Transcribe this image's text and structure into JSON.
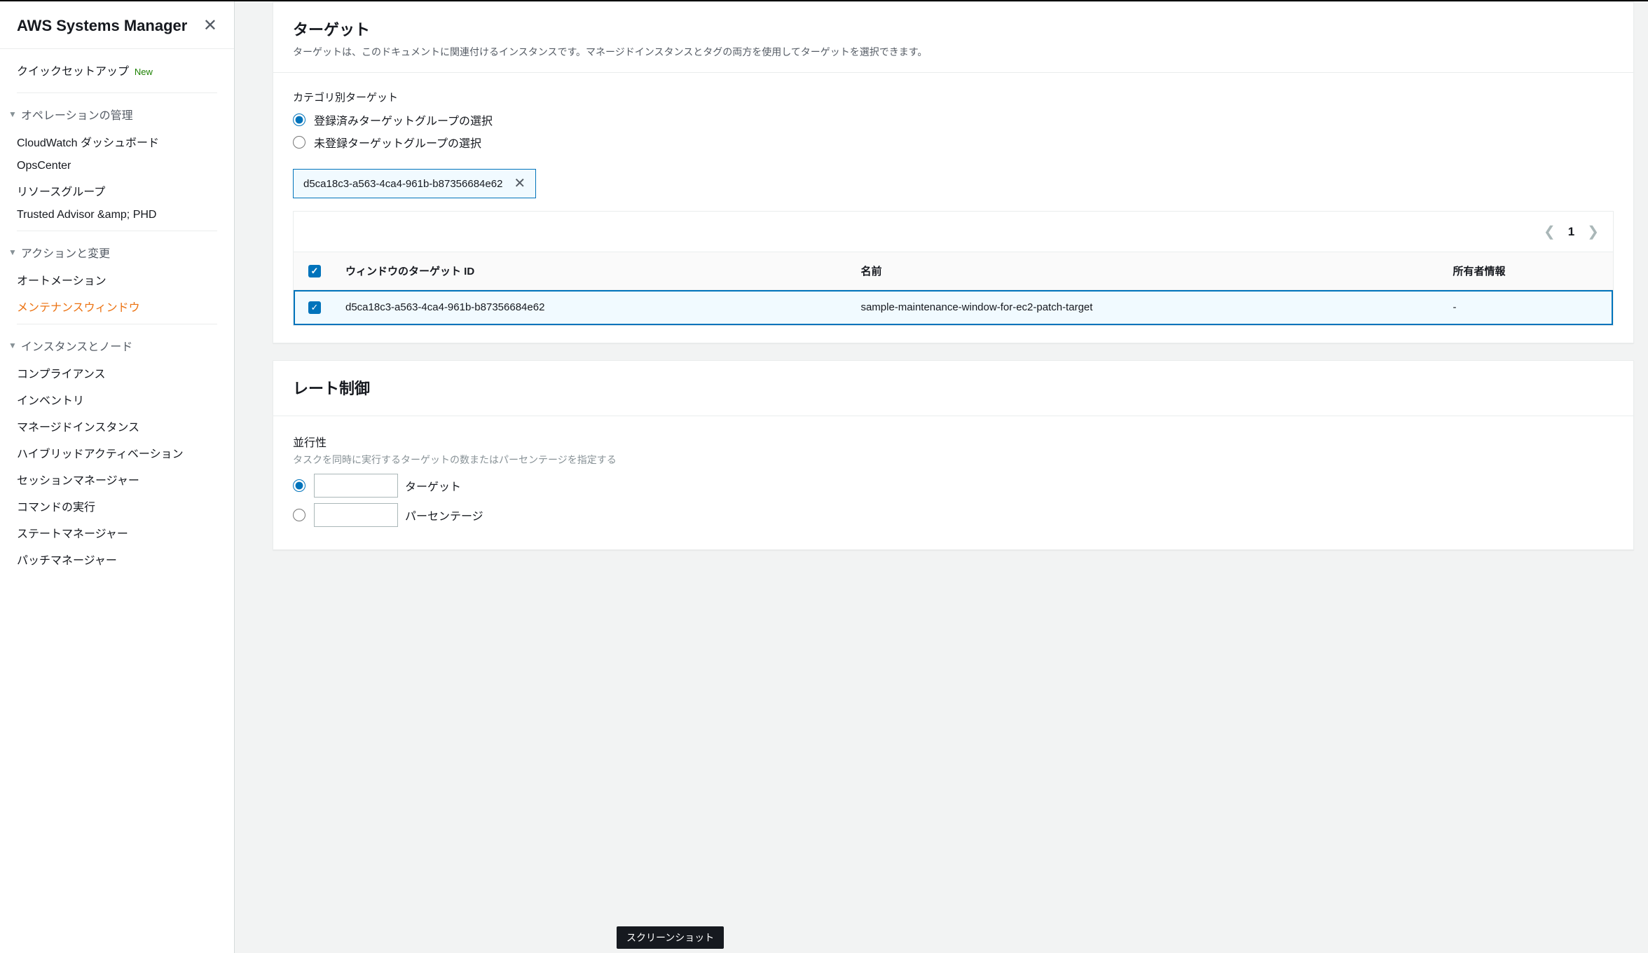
{
  "sidebar": {
    "title": "AWS Systems Manager",
    "quick_setup": "クイックセットアップ",
    "new_badge": "New",
    "groups": [
      {
        "label": "オペレーションの管理",
        "items": [
          "CloudWatch ダッシュボード",
          "OpsCenter",
          "リソースグループ",
          "Trusted Advisor &amp; PHD"
        ]
      },
      {
        "label": "アクションと変更",
        "items": [
          "オートメーション",
          "メンテナンスウィンドウ"
        ],
        "active_index": 1
      },
      {
        "label": "インスタンスとノード",
        "items": [
          "コンプライアンス",
          "インベントリ",
          "マネージドインスタンス",
          "ハイブリッドアクティベーション",
          "セッションマネージャー",
          "コマンドの実行",
          "ステートマネージャー",
          "パッチマネージャー"
        ]
      }
    ]
  },
  "targets_panel": {
    "title": "ターゲット",
    "desc": "ターゲットは、このドキュメントに関連付けるインスタンスです。マネージドインスタンスとタグの両方を使用してターゲットを選択できます。",
    "category_label": "カテゴリ別ターゲット",
    "radio_registered": "登録済みターゲットグループの選択",
    "radio_unregistered": "未登録ターゲットグループの選択",
    "token": "d5ca18c3-a563-4ca4-961b-b87356684e62",
    "page": "1",
    "columns": {
      "target_id": "ウィンドウのターゲット ID",
      "name": "名前",
      "owner": "所有者情報"
    },
    "rows": [
      {
        "id": "d5ca18c3-a563-4ca4-961b-b87356684e62",
        "name": "sample-maintenance-window-for-ec2-patch-target",
        "owner": "-",
        "selected": true
      }
    ]
  },
  "rate_panel": {
    "title": "レート制御",
    "concurrency_label": "並行性",
    "concurrency_desc": "タスクを同時に実行するターゲットの数またはパーセンテージを指定する",
    "radio_targets": "ターゲット",
    "radio_percentage": "パーセンテージ"
  },
  "tooltip": "スクリーンショット"
}
